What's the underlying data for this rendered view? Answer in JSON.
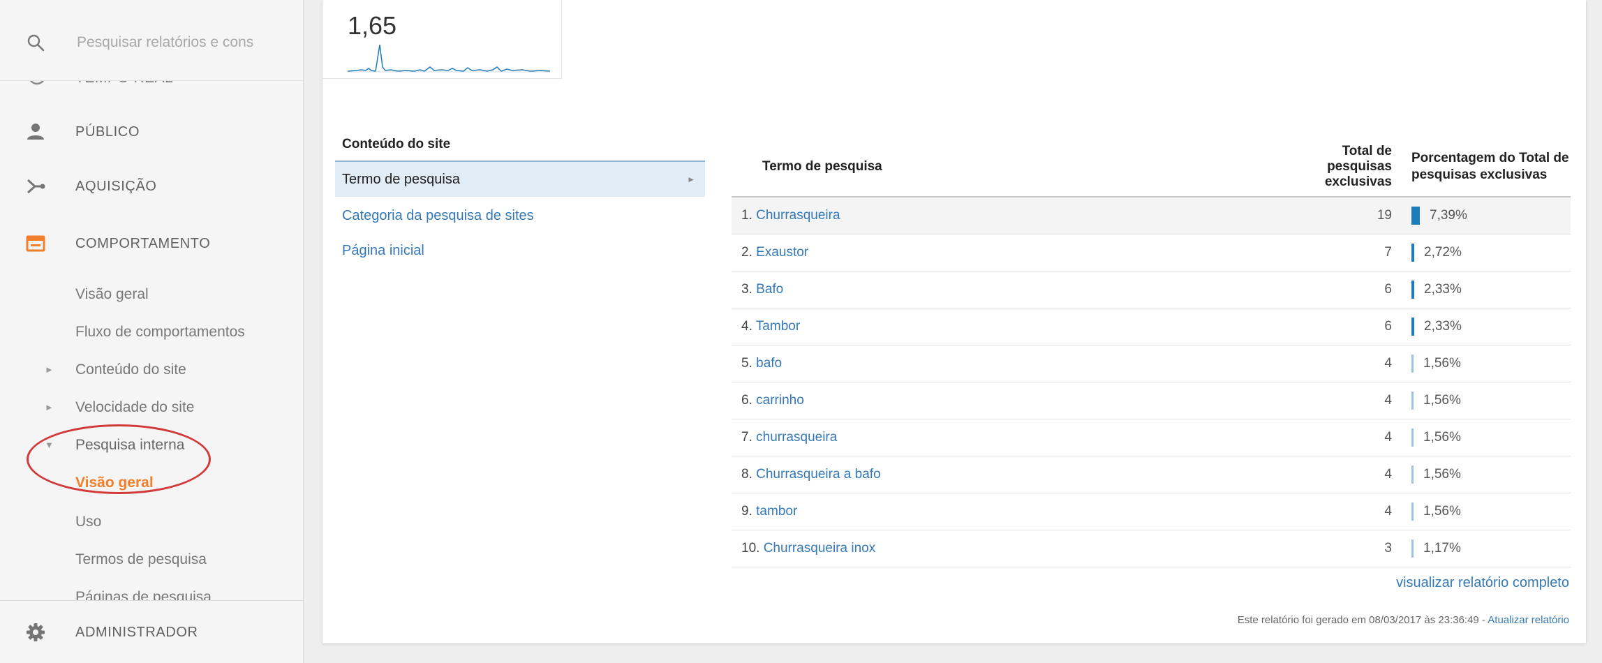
{
  "sidebar": {
    "search_placeholder": "Pesquisar relatórios e cons",
    "cut_item_label": "TEMPO REAL",
    "nav": {
      "publico": "PÚBLICO",
      "aquisicao": "AQUISIÇÃO",
      "comportamento": "COMPORTAMENTO",
      "administrador": "ADMINISTRADOR"
    },
    "sub_items": {
      "visao_geral": "Visão geral",
      "fluxo": "Fluxo de comportamentos",
      "conteudo": "Conteúdo do site",
      "velocidade": "Velocidade do site",
      "pesquisa_interna": "Pesquisa interna",
      "pesquisa_visao_geral": "Visão geral",
      "uso": "Uso",
      "termos": "Termos de pesquisa",
      "paginas": "Páginas de pesquisa"
    }
  },
  "sparkline": {
    "value": "1,65"
  },
  "left_nav": {
    "header": "Conteúdo do site",
    "selected": "Termo de pesquisa",
    "links": [
      "Categoria da pesquisa de sites",
      "Página inicial"
    ]
  },
  "table": {
    "headers": {
      "term": "Termo de pesquisa",
      "total_l1": "Total de",
      "total_l2": "pesquisas",
      "total_l3": "exclusivas",
      "pct_l1": "Porcentagem do Total de",
      "pct_l2": "pesquisas exclusivas"
    },
    "rows": [
      {
        "num": "1.",
        "term": "Churrasqueira",
        "total": "19",
        "pct": "7,39%",
        "pct_value": 7.39
      },
      {
        "num": "2.",
        "term": "Exaustor",
        "total": "7",
        "pct": "2,72%",
        "pct_value": 2.72
      },
      {
        "num": "3.",
        "term": "Bafo",
        "total": "6",
        "pct": "2,33%",
        "pct_value": 2.33
      },
      {
        "num": "4.",
        "term": "Tambor",
        "total": "6",
        "pct": "2,33%",
        "pct_value": 2.33
      },
      {
        "num": "5.",
        "term": "bafo",
        "total": "4",
        "pct": "1,56%",
        "pct_value": 1.56
      },
      {
        "num": "6.",
        "term": "carrinho",
        "total": "4",
        "pct": "1,56%",
        "pct_value": 1.56
      },
      {
        "num": "7.",
        "term": "churrasqueira",
        "total": "4",
        "pct": "1,56%",
        "pct_value": 1.56
      },
      {
        "num": "8.",
        "term": "Churrasqueira a bafo",
        "total": "4",
        "pct": "1,56%",
        "pct_value": 1.56
      },
      {
        "num": "9.",
        "term": "tambor",
        "total": "4",
        "pct": "1,56%",
        "pct_value": 1.56
      },
      {
        "num": "10.",
        "term": "Churrasqueira inox",
        "total": "3",
        "pct": "1,17%",
        "pct_value": 1.17
      }
    ]
  },
  "footer": {
    "full_report": "visualizar relatório completo",
    "generated": "Este relatório foi gerado em 08/03/2017 às 23:36:49 - ",
    "update_link": "Atualizar relatório"
  },
  "colors": {
    "accent_orange": "#f17f2b",
    "link_blue": "#3479b6",
    "bar_blue": "#1f7ab8",
    "annotation_red": "#d23a3a"
  }
}
